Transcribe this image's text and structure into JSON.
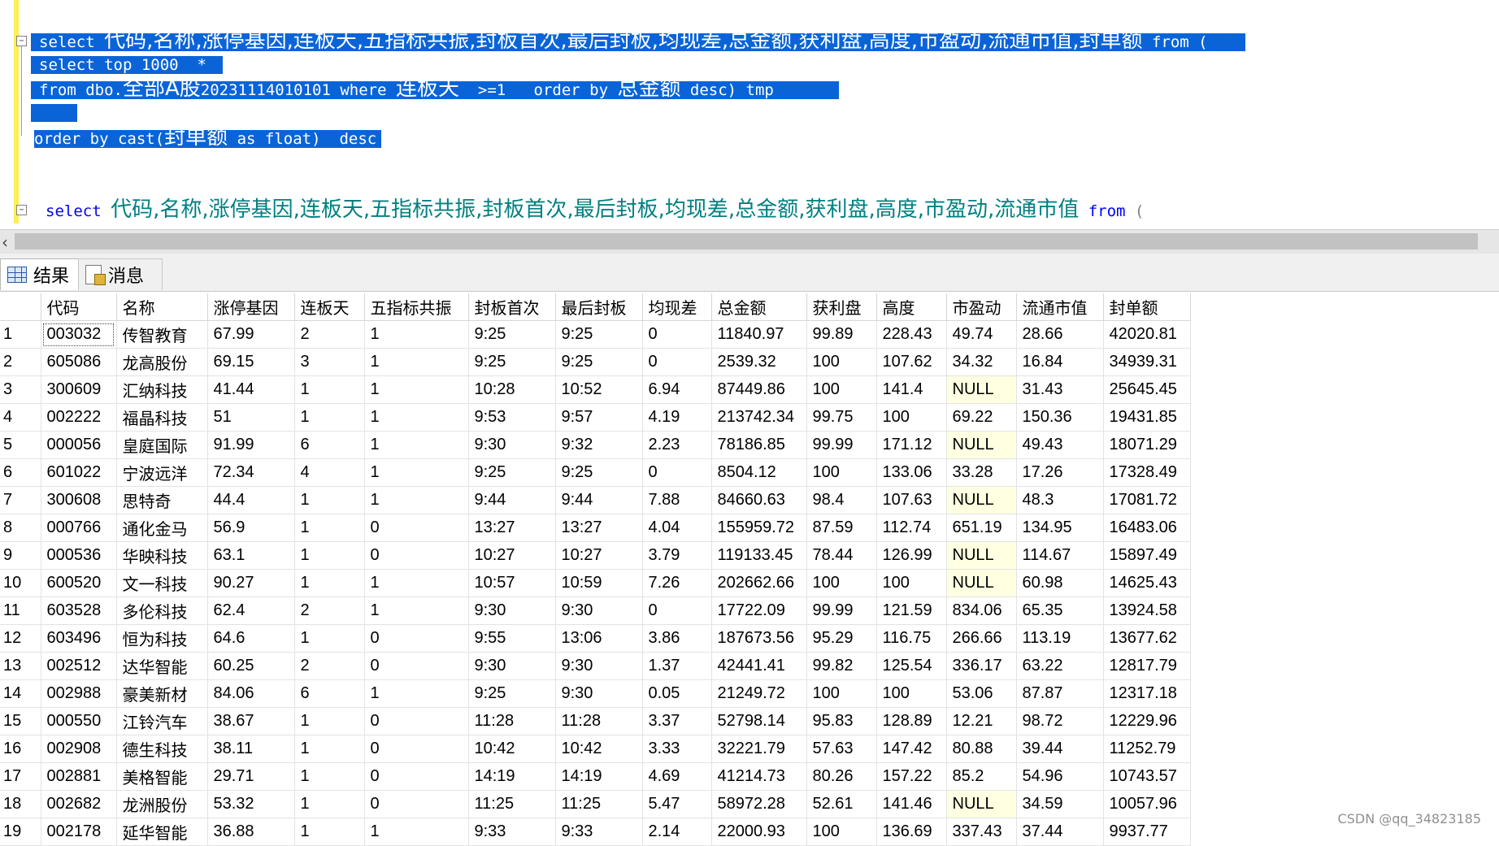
{
  "editor": {
    "sel_line1": {
      "kw1": "select ",
      "cols": "代码,名称,涨停基因,连板天,五指标共振,封板首次,最后封板,均现差,总金额,获利盘,高度,市盈动,流通市值,封单额",
      "kw2": " from ("
    },
    "sel_line2": "select top 1000  *",
    "sel_line3": {
      "kw1": "from dbo.",
      "tbl_zh": "全部A股",
      "tbl_num": "20231114010101",
      "kw2": " where ",
      "col": "连板天",
      "cond": "  >=1   order by ",
      "col2": "总金额",
      "tail": " desc) tmp"
    },
    "sel_line5": {
      "kw1": "order by cast(",
      "col": "封单额",
      "tail": " as float)  desc"
    },
    "line7": {
      "kw1": "select ",
      "cols": "代码,名称,涨停基因,连板天,五指标共振,封板首次,最后封板,均现差,总金额,获利盘,高度,市盈动,流通市值",
      "kw2": " from",
      "paren": " ("
    }
  },
  "tabs": [
    {
      "label": "结果",
      "icon": "grid-icon"
    },
    {
      "label": "消息",
      "icon": "message-icon"
    }
  ],
  "grid": {
    "columns": [
      "代码",
      "名称",
      "涨停基因",
      "连板天",
      "五指标共振",
      "封板首次",
      "最后封板",
      "均现差",
      "总金额",
      "获利盘",
      "高度",
      "市盈动",
      "流通市值",
      "封单额"
    ],
    "rows": [
      [
        "1",
        "003032",
        "传智教育",
        "67.99",
        "2",
        "1",
        "9:25",
        "9:25",
        "0",
        "11840.97",
        "99.89",
        "228.43",
        "49.74",
        "28.66",
        "42020.81"
      ],
      [
        "2",
        "605086",
        "龙高股份",
        "69.15",
        "3",
        "1",
        "9:25",
        "9:25",
        "0",
        "2539.32",
        "100",
        "107.62",
        "34.32",
        "16.84",
        "34939.31"
      ],
      [
        "3",
        "300609",
        "汇纳科技",
        "41.44",
        "1",
        "1",
        "10:28",
        "10:52",
        "6.94",
        "87449.86",
        "100",
        "141.4",
        "NULL",
        "31.43",
        "25645.45"
      ],
      [
        "4",
        "002222",
        "福晶科技",
        "51",
        "1",
        "1",
        "9:53",
        "9:57",
        "4.19",
        "213742.34",
        "99.75",
        "100",
        "69.22",
        "150.36",
        "19431.85"
      ],
      [
        "5",
        "000056",
        "皇庭国际",
        "91.99",
        "6",
        "1",
        "9:30",
        "9:32",
        "2.23",
        "78186.85",
        "99.99",
        "171.12",
        "NULL",
        "49.43",
        "18071.29"
      ],
      [
        "6",
        "601022",
        "宁波远洋",
        "72.34",
        "4",
        "1",
        "9:25",
        "9:25",
        "0",
        "8504.12",
        "100",
        "133.06",
        "33.28",
        "17.26",
        "17328.49"
      ],
      [
        "7",
        "300608",
        "思特奇",
        "44.4",
        "1",
        "1",
        "9:44",
        "9:44",
        "7.88",
        "84660.63",
        "98.4",
        "107.63",
        "NULL",
        "48.3",
        "17081.72"
      ],
      [
        "8",
        "000766",
        "通化金马",
        "56.9",
        "1",
        "0",
        "13:27",
        "13:27",
        "4.04",
        "155959.72",
        "87.59",
        "112.74",
        "651.19",
        "134.95",
        "16483.06"
      ],
      [
        "9",
        "000536",
        "华映科技",
        "63.1",
        "1",
        "0",
        "10:27",
        "10:27",
        "3.79",
        "119133.45",
        "78.44",
        "126.99",
        "NULL",
        "114.67",
        "15897.49"
      ],
      [
        "10",
        "600520",
        "文一科技",
        "90.27",
        "1",
        "1",
        "10:57",
        "10:59",
        "7.26",
        "202662.66",
        "100",
        "100",
        "NULL",
        "60.98",
        "14625.43"
      ],
      [
        "11",
        "603528",
        "多伦科技",
        "62.4",
        "2",
        "1",
        "9:30",
        "9:30",
        "0",
        "17722.09",
        "99.99",
        "121.59",
        "834.06",
        "65.35",
        "13924.58"
      ],
      [
        "12",
        "603496",
        "恒为科技",
        "64.6",
        "1",
        "0",
        "9:55",
        "13:06",
        "3.86",
        "187673.56",
        "95.29",
        "116.75",
        "266.66",
        "113.19",
        "13677.62"
      ],
      [
        "13",
        "002512",
        "达华智能",
        "60.25",
        "2",
        "0",
        "9:30",
        "9:30",
        "1.37",
        "42441.41",
        "99.82",
        "125.54",
        "336.17",
        "63.22",
        "12817.79"
      ],
      [
        "14",
        "002988",
        "豪美新材",
        "84.06",
        "6",
        "1",
        "9:25",
        "9:30",
        "0.05",
        "21249.72",
        "100",
        "100",
        "53.06",
        "87.87",
        "12317.18"
      ],
      [
        "15",
        "000550",
        "江铃汽车",
        "38.67",
        "1",
        "0",
        "11:28",
        "11:28",
        "3.37",
        "52798.14",
        "95.83",
        "128.89",
        "12.21",
        "98.72",
        "12229.96"
      ],
      [
        "16",
        "002908",
        "德生科技",
        "38.11",
        "1",
        "0",
        "10:42",
        "10:42",
        "3.33",
        "32221.79",
        "57.63",
        "147.42",
        "80.88",
        "39.44",
        "11252.79"
      ],
      [
        "17",
        "002881",
        "美格智能",
        "29.71",
        "1",
        "0",
        "14:19",
        "14:19",
        "4.69",
        "41214.73",
        "80.26",
        "157.22",
        "85.2",
        "54.96",
        "10743.57"
      ],
      [
        "18",
        "002682",
        "龙洲股份",
        "53.32",
        "1",
        "0",
        "11:25",
        "11:25",
        "5.47",
        "58972.28",
        "52.61",
        "141.46",
        "NULL",
        "34.59",
        "10057.96"
      ],
      [
        "19",
        "002178",
        "延华智能",
        "36.88",
        "1",
        "1",
        "9:33",
        "9:33",
        "2.14",
        "22000.93",
        "100",
        "136.69",
        "337.43",
        "37.44",
        "9937.77"
      ]
    ]
  },
  "watermark": "CSDN @qq_34823185",
  "colors": {
    "selection": "#0a64d8",
    "keyword": "#0000ff",
    "identifier": "#008080",
    "null_cell": "#ffffe1"
  }
}
